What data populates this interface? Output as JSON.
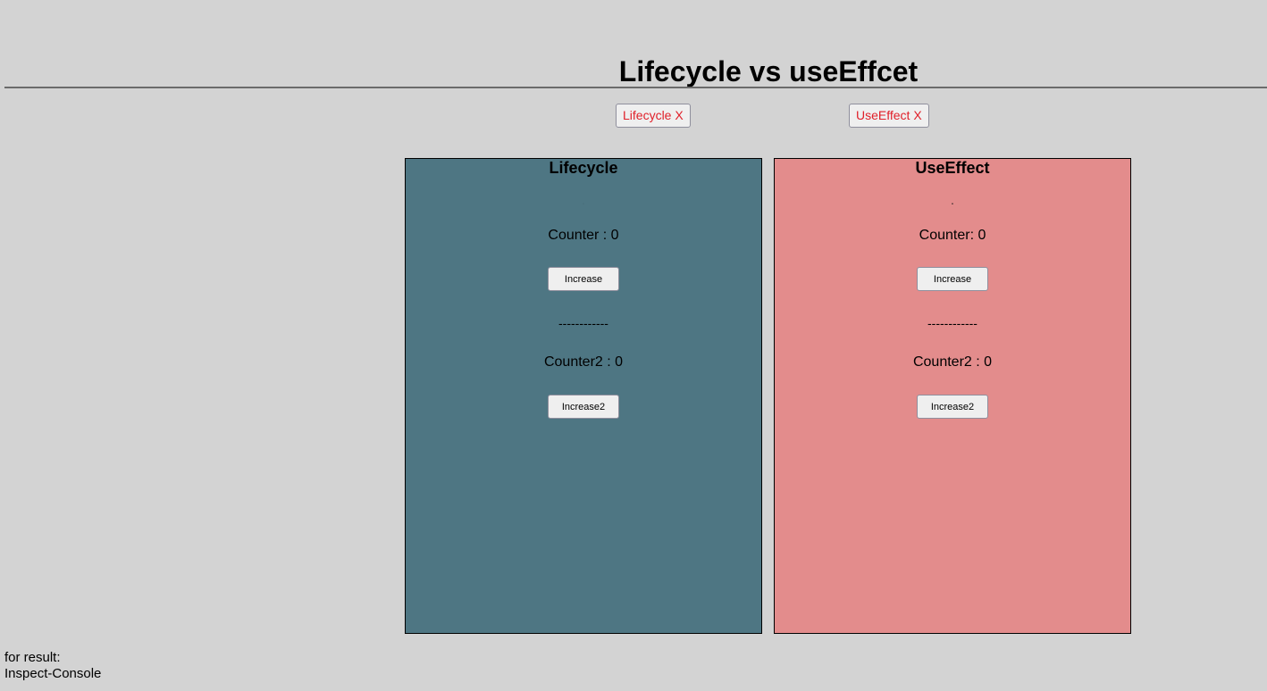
{
  "page": {
    "title": "Lifecycle vs useEffcet"
  },
  "toggles": {
    "lifecycle_label": "Lifecycle X",
    "useeffect_label": "UseEffect X"
  },
  "lifecycle_panel": {
    "title": "Lifecycle",
    "marker": ".",
    "counter_text": "Counter : 0",
    "increase_label": "Increase",
    "divider": "------------",
    "counter2_text": "Counter2 : 0",
    "increase2_label": "Increase2"
  },
  "useeffect_panel": {
    "title": "UseEffect",
    "marker": ".",
    "counter_text": "Counter: 0",
    "increase_label": "Increase",
    "divider": "------------",
    "counter2_text": "Counter2 : 0",
    "increase2_label": "Increase2"
  },
  "footer": {
    "line1": "for result:",
    "line2": "Inspect-Console"
  },
  "colors": {
    "background": "#d3d3d3",
    "lifecycle_panel": "#4e7683",
    "useeffect_panel": "#e38c8c",
    "toggle_text": "#e0202a"
  }
}
